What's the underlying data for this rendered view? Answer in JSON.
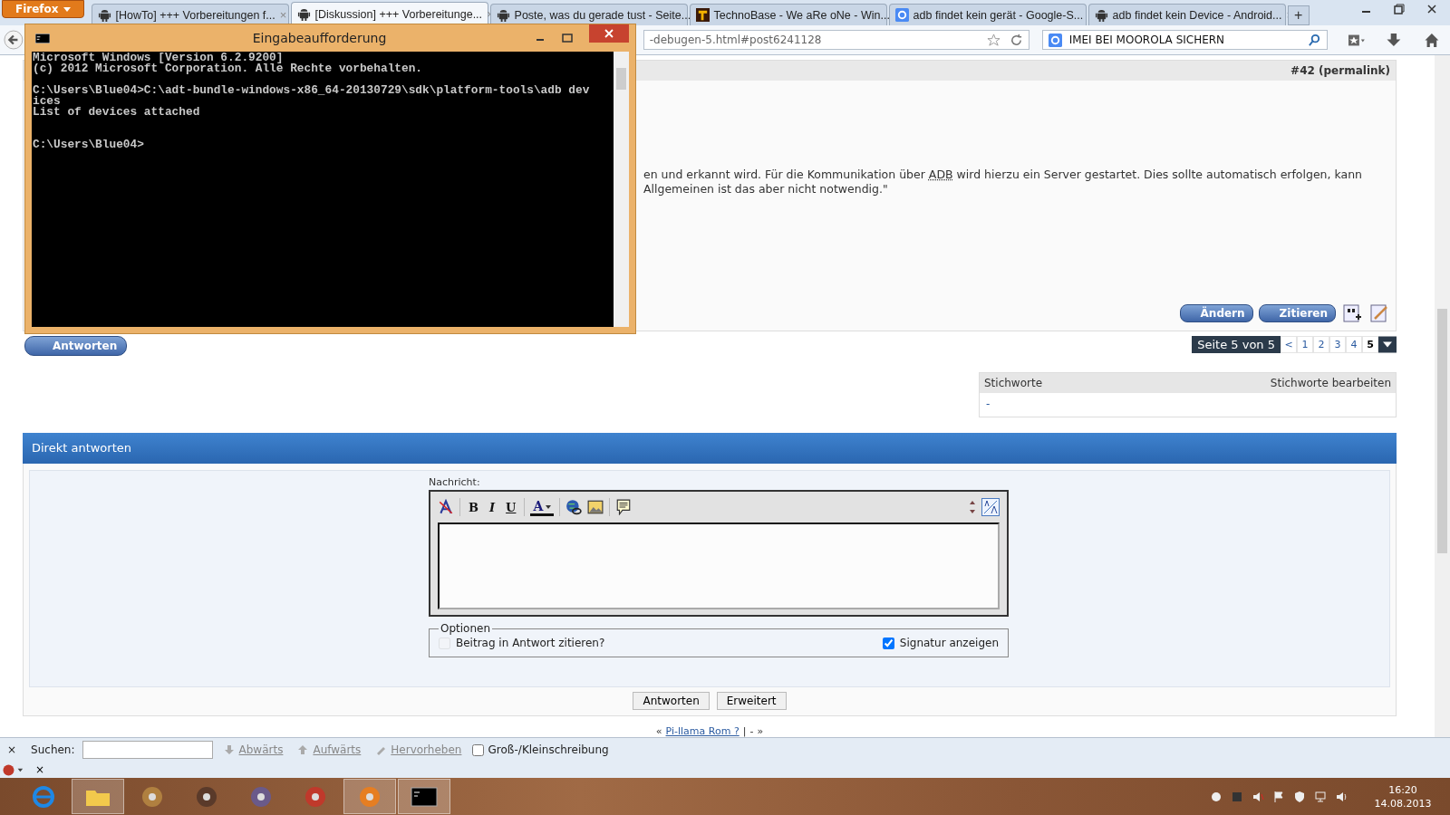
{
  "browser": {
    "menu_button": "Firefox",
    "tabs": [
      {
        "label": "[HowTo] +++ Vorbereitungen f...",
        "selected": false,
        "kind": "forum"
      },
      {
        "label": "[Diskussion] +++ Vorbereitunge...",
        "selected": true,
        "kind": "forum"
      },
      {
        "label": "Poste, was du gerade tust - Seite...",
        "selected": false,
        "kind": "forum"
      },
      {
        "label": "TechnoBase - We aRe oNe - Win...",
        "selected": false,
        "kind": "techno"
      },
      {
        "label": "adb findet kein gerät - Google-S...",
        "selected": false,
        "kind": "search"
      },
      {
        "label": "adb findet kein Device - Android...",
        "selected": false,
        "kind": "forum"
      }
    ],
    "tab_close": "×",
    "new_tab": "+",
    "url": "-debugen-5.html#post6241128",
    "search_value": "IMEI BEI MOOROLA SICHERN"
  },
  "post": {
    "number": "#42",
    "permalink": "(permalink)",
    "line1_before": "en und erkannt wird. Für die Kommunikation über ",
    "abbr": "ADB",
    "line1_after": " wird hierzu ein Server gestartet. Dies sollte automatisch erfolgen, kann",
    "line2": "Allgemeinen ist das aber nicht notwendig.\"",
    "buttons": [
      "Ändern",
      "Zitieren"
    ]
  },
  "reply_button": "Antworten",
  "pagination": {
    "label": "Seite 5 von 5",
    "prev": "<",
    "pages": [
      {
        "label": "1",
        "selected": false
      },
      {
        "label": "2",
        "selected": false
      },
      {
        "label": "3",
        "selected": false
      },
      {
        "label": "4",
        "selected": false
      },
      {
        "label": "5",
        "selected": true
      }
    ]
  },
  "tags": {
    "title": "Stichworte",
    "edit": "Stichworte bearbeiten",
    "value": "-"
  },
  "quick_reply": {
    "title": "Direkt antworten",
    "message_label": "Nachricht:",
    "bold": "B",
    "italic": "I",
    "underline": "U",
    "font_color": "A",
    "options_legend": "Optionen",
    "options": [
      {
        "label": "Beitrag in Antwort zitieren?",
        "checked": false,
        "disabled": true
      },
      {
        "label": "Signatur anzeigen",
        "checked": true,
        "disabled": false
      }
    ],
    "buttons": [
      "Antworten",
      "Erweitert"
    ]
  },
  "thread_nav": {
    "prev": "«",
    "link": "Pi-llama Rom ?",
    "separator": "|",
    "middle": "-",
    "next": "»"
  },
  "find_bar": {
    "close": "×",
    "label": "Suchen:",
    "down": "Abwärts",
    "up": "Aufwärts",
    "highlight": "Hervorheben",
    "match_case": {
      "label": "Groß-/Kleinschreibung",
      "checked": false
    }
  },
  "addon_bar": {
    "close": "×"
  },
  "console": {
    "title": "Eingabeaufforderung",
    "output": "Microsoft Windows [Version 6.2.9200]\n(c) 2012 Microsoft Corporation. Alle Rechte vorbehalten.\n\nC:\\Users\\Blue04>C:\\adt-bundle-windows-x86_64-20130729\\sdk\\platform-tools\\adb dev\nices\nList of devices attached\n\n\nC:\\Users\\Blue04>"
  },
  "taskbar": {
    "apps": [
      {
        "kind": "browser-e",
        "running": false
      },
      {
        "kind": "folder",
        "running": true
      },
      {
        "kind": "speaker",
        "running": false
      },
      {
        "kind": "disc",
        "running": false
      },
      {
        "kind": "box",
        "running": false
      },
      {
        "kind": "power",
        "running": false
      },
      {
        "kind": "fox",
        "running": true
      },
      {
        "kind": "console",
        "running": true
      }
    ],
    "time": "16:20",
    "date": "14.08.2013"
  }
}
